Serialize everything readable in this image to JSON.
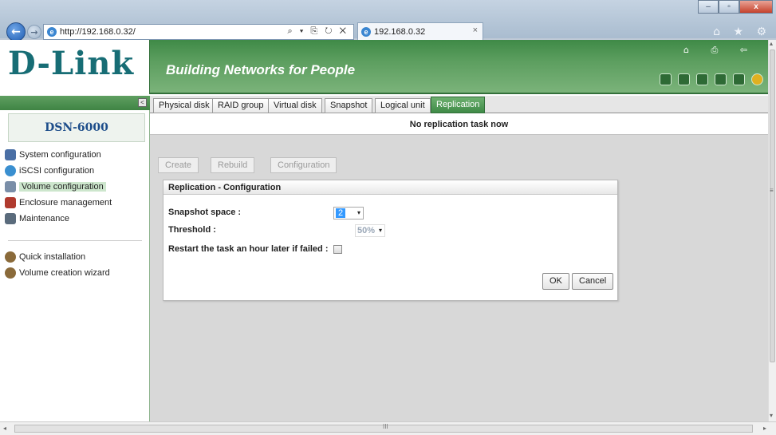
{
  "browser": {
    "address": "http://192.168.0.32/",
    "address_actions": "⌕ ▾ ⎘ ↻ ✕",
    "tab_title": "192.168.0.32",
    "tab_close": "×",
    "back_glyph": "←",
    "forward_glyph": "→",
    "window_controls": [
      "–",
      "▫",
      "x"
    ],
    "tool_icons": "⌂ ★ ⚙"
  },
  "header": {
    "logo": "D-Link",
    "tagline": "Building Networks for People",
    "top_icons": "⌂ ⎙ ⇦"
  },
  "sidebar": {
    "collapse_glyph": "<",
    "device": "DSN-6000",
    "items": [
      {
        "label": "System configuration",
        "icon": "gear-icon",
        "color": "#4a6fa5"
      },
      {
        "label": "iSCSI configuration",
        "icon": "globe-icon",
        "color": "#3a8fd0"
      },
      {
        "label": "Volume configuration",
        "icon": "volume-icon",
        "color": "#7a8ea8"
      },
      {
        "label": "Enclosure management",
        "icon": "enclosure-icon",
        "color": "#b03a2e"
      },
      {
        "label": "Maintenance",
        "icon": "maintenance-icon",
        "color": "#5a6b7c"
      }
    ],
    "quick_items": [
      {
        "label": "Quick installation",
        "icon": "install-icon",
        "color": "#8a6a3a"
      },
      {
        "label": "Volume creation wizard",
        "icon": "wizard-icon",
        "color": "#8a6a3a"
      }
    ]
  },
  "tabs": [
    {
      "label": "Physical disk"
    },
    {
      "label": "RAID group"
    },
    {
      "label": "Virtual disk"
    },
    {
      "label": "Snapshot"
    },
    {
      "label": "Logical unit"
    },
    {
      "label": "Replication"
    }
  ],
  "main": {
    "status": "No replication task now",
    "actions": {
      "create": "Create",
      "rebuild": "Rebuild",
      "configuration": "Configuration"
    }
  },
  "dialog": {
    "title": "Replication - Configuration",
    "snapshot_space_label": "Snapshot space :",
    "snapshot_space_value": "2",
    "threshold_label": "Threshold :",
    "threshold_value": "50%",
    "restart_label": "Restart the task an hour later if failed :",
    "restart_checked": false,
    "ok": "OK",
    "cancel": "Cancel"
  },
  "scrollbar": {
    "grip": "III",
    "left": "◂",
    "right": "▸",
    "up": "▴",
    "down": "▾",
    "mark": "≡"
  },
  "colors": {
    "brand_green": "#3f8a47",
    "logo_teal": "#176d75",
    "device_blue": "#1d4d8a"
  }
}
